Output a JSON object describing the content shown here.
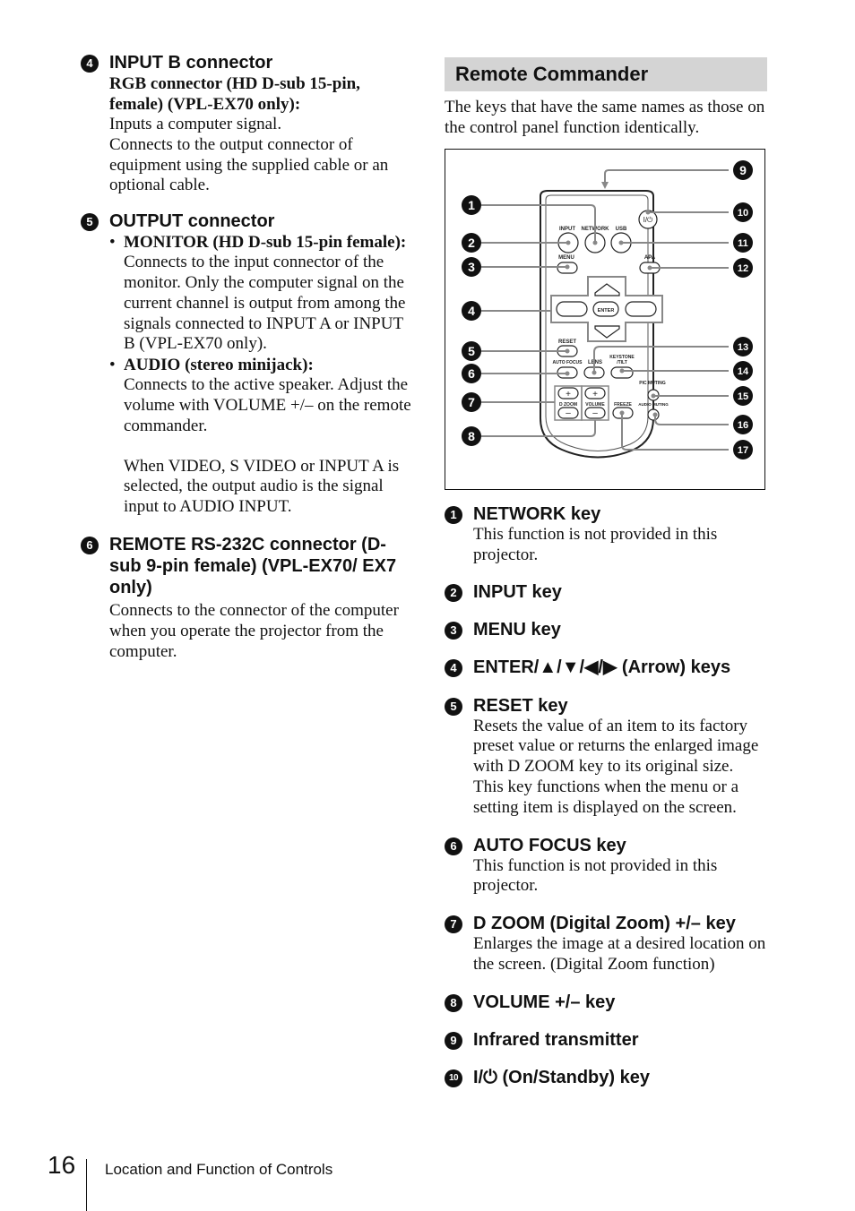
{
  "left_column": {
    "items": [
      {
        "number": "4",
        "title": "INPUT B connector",
        "subtitle": "RGB connector (HD D-sub 15-pin, female) (VPL-EX70 only):",
        "lines": [
          "Inputs a computer signal.",
          "Connects to the output connector of equipment using the supplied cable or an optional cable."
        ]
      },
      {
        "number": "5",
        "title": "OUTPUT connector",
        "bullets": [
          {
            "label": "MONITOR (HD D-sub 15-pin female):",
            "text": "Connects to the input connector of the monitor. Only the computer signal on the current channel is output from among the signals connected to INPUT A or INPUT B (VPL-EX70 only)."
          },
          {
            "label": "AUDIO (stereo minijack):",
            "text": "Connects to the active speaker. Adjust the volume with VOLUME +/– on the remote commander.",
            "extra": "When VIDEO, S VIDEO or INPUT A is selected, the output audio is the signal input to AUDIO INPUT."
          }
        ]
      },
      {
        "number": "6",
        "title": "REMOTE RS-232C connector (D-sub 9-pin female) (VPL-EX70/ EX7 only)",
        "lines": [
          "Connects to the connector of the computer when you operate the projector from the computer."
        ]
      }
    ]
  },
  "right_column": {
    "section_title": "Remote Commander",
    "intro": "The keys that have the same names as those on the control panel function identically.",
    "figure": {
      "callouts": [
        "1",
        "2",
        "3",
        "4",
        "5",
        "6",
        "7",
        "8",
        "9",
        "10",
        "11",
        "12",
        "13",
        "14",
        "15",
        "16",
        "17"
      ],
      "key_labels": {
        "input": "INPUT",
        "network": "NETWORK",
        "usb": "USB",
        "menu": "MENU",
        "apa": "APA",
        "enter": "ENTER",
        "reset": "RESET",
        "auto_focus": "AUTO FOCUS",
        "lens": "LENS",
        "keystone": "KEYSTONE",
        "tilt": "/TILT",
        "pic_muting": "PIC MUTING",
        "d_zoom": "D ZOOM",
        "volume": "VOLUME",
        "freeze": "FREEZE",
        "audio_muting": "AUDIO MUTING",
        "power": "I/⏻",
        "plus": "+",
        "minus": "–"
      }
    },
    "items": [
      {
        "number": "1",
        "title": "NETWORK key",
        "text": "This function is not provided in this projector."
      },
      {
        "number": "2",
        "title": "INPUT key"
      },
      {
        "number": "3",
        "title": "MENU key"
      },
      {
        "number": "4",
        "title": "ENTER/▲/▼/◀/▶ (Arrow) keys"
      },
      {
        "number": "5",
        "title": "RESET key",
        "text": "Resets the value of an item to its factory preset value or returns the enlarged image with D ZOOM key to its original size. This key functions when the menu or a setting item is displayed on the screen."
      },
      {
        "number": "6",
        "title": "AUTO FOCUS key",
        "text": "This function is not provided in this projector."
      },
      {
        "number": "7",
        "title": "D ZOOM (Digital Zoom) +/– key",
        "text": "Enlarges the image at a desired location on the screen. (Digital Zoom function)"
      },
      {
        "number": "8",
        "title": "VOLUME +/– key"
      },
      {
        "number": "9",
        "title": "Infrared transmitter"
      },
      {
        "number": "10",
        "title": "I/⏻ (On/Standby) key"
      }
    ]
  },
  "footer": {
    "page_number": "16",
    "section": "Location and Function of Controls"
  }
}
